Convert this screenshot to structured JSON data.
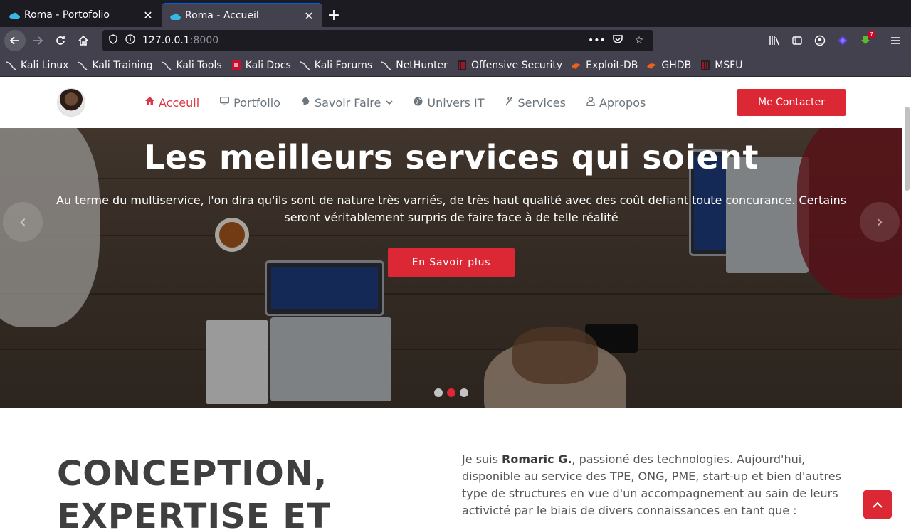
{
  "browser": {
    "tabs": [
      {
        "title": "Roma - Portofolio",
        "active": false
      },
      {
        "title": "Roma - Accueil",
        "active": true
      }
    ],
    "url": {
      "host": "127.0.0.1",
      "port": ":8000"
    },
    "bookmarks": [
      "Kali Linux",
      "Kali Training",
      "Kali Tools",
      "Kali Docs",
      "Kali Forums",
      "NetHunter",
      "Offensive Security",
      "Exploit-DB",
      "GHDB",
      "MSFU"
    ],
    "download_badge": "7"
  },
  "site": {
    "nav": {
      "home": "Acceuil",
      "portfolio": "Portfolio",
      "savoir_faire": "Savoir Faire",
      "univers": "Univers IT",
      "services": "Services",
      "apropos": "Apropos"
    },
    "contact_button": "Me Contacter",
    "hero": {
      "title": "Les meilleurs services qui soient",
      "lead": "Au terme du multiservice, l'on dira qu'ils sont de nature très varriés, de très haut qualité avec des coût defiant toute concurance. Certains seront véritablement surpris de faire face à de telle réalité",
      "cta": "En Savoir plus",
      "active_slide": 2,
      "slide_count": 3
    },
    "about": {
      "heading_line1": "CONCEPTION,",
      "heading_line2": "EXPERTISE ET",
      "intro_before": "Je suis ",
      "name": "Romaric G.",
      "intro_after": ", passioné des technologies. Aujourd'hui, disponible au service des TPE, ONG, PME, start-up et bien d'autres type de structures en vue d'un accompagnement au sain de leurs activicté par le biais de divers connaissances en tant que :"
    }
  },
  "colors": {
    "accent": "#dc2734",
    "chrome_dark": "#1c1b22",
    "chrome": "#42414d"
  }
}
